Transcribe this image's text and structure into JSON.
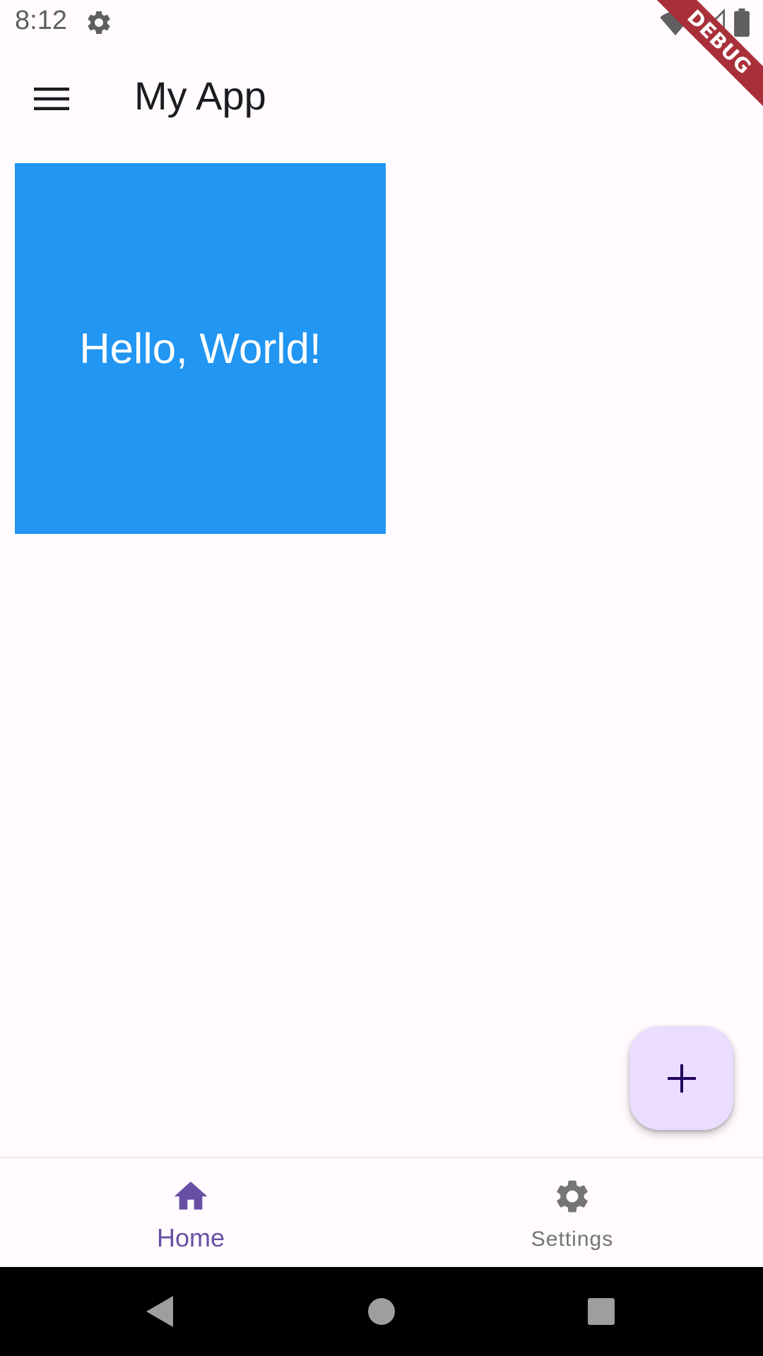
{
  "status_bar": {
    "time": "8:12",
    "icons": [
      "settings-gear-icon",
      "wifi-icon",
      "signal-icon",
      "battery-icon"
    ]
  },
  "debug_banner": {
    "label": "DEBUG",
    "color": "#A9303A"
  },
  "app_bar": {
    "title": "My App",
    "menu_icon": "hamburger-menu-icon"
  },
  "content": {
    "box_text": "Hello, World!",
    "box_color": "#2196F3"
  },
  "fab": {
    "icon": "plus-icon",
    "color": "#EADDFF"
  },
  "bottom_nav": {
    "items": [
      {
        "label": "Home",
        "icon": "home-icon",
        "active": true
      },
      {
        "label": "Settings",
        "icon": "settings-icon",
        "active": false
      }
    ],
    "active_color": "#6750A4",
    "inactive_color": "#757575"
  },
  "system_nav": {
    "buttons": [
      "back-icon",
      "home-circle-icon",
      "recents-icon"
    ]
  }
}
